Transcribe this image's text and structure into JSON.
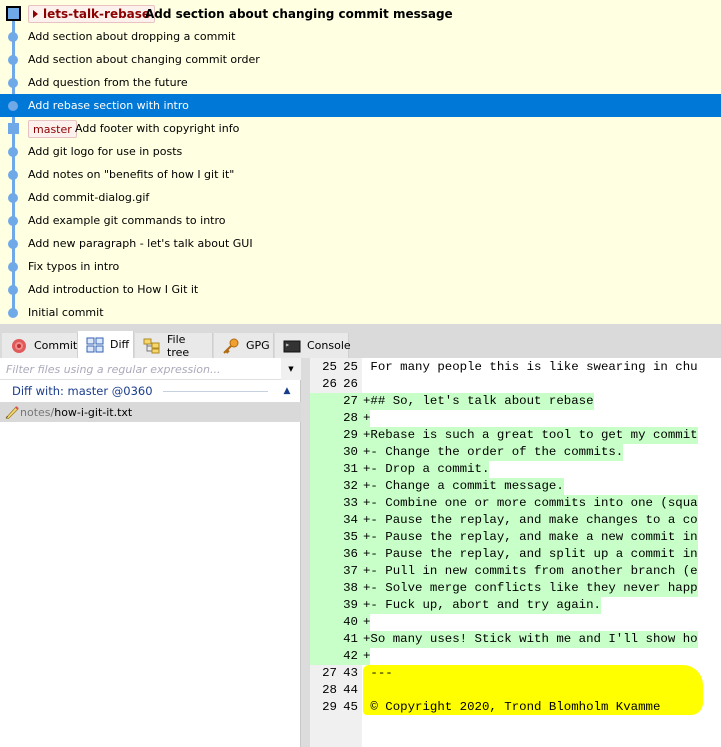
{
  "commit_log": {
    "colors": {
      "background": "#ffffe1",
      "selected": "#0078d7",
      "graph": "#70a9e8",
      "badge_text": "#8b0000"
    },
    "commits": [
      {
        "message": "Add section about changing commit message",
        "branch": "lets-talk-rebase",
        "head": true,
        "bold": true
      },
      {
        "message": "Add section about dropping a commit"
      },
      {
        "message": "Add section about changing commit order"
      },
      {
        "message": "Add question from the future"
      },
      {
        "message": "Add rebase section with intro",
        "selected": true
      },
      {
        "message": "Add footer with copyright info",
        "branch": "master"
      },
      {
        "message": "Add git logo for use in posts"
      },
      {
        "message": "Add notes on \"benefits of how I git it\""
      },
      {
        "message": "Add commit-dialog.gif"
      },
      {
        "message": "Add example git commands to intro"
      },
      {
        "message": "Add new paragraph - let's talk about GUI"
      },
      {
        "message": "Fix typos in intro"
      },
      {
        "message": "Add introduction to How I Git it"
      },
      {
        "message": "Initial commit"
      }
    ]
  },
  "tabs": [
    {
      "label": "Commit",
      "icon": "commit-icon"
    },
    {
      "label": "Diff",
      "icon": "diff-icon",
      "active": true
    },
    {
      "label": "File tree",
      "icon": "file-tree-icon"
    },
    {
      "label": "GPG",
      "icon": "key-icon"
    },
    {
      "label": "Console",
      "icon": "console-icon"
    }
  ],
  "file_panel": {
    "filter_placeholder": "Filter files using a regular expression...",
    "diff_with": "Diff with: master @0360",
    "files": [
      {
        "dir": "notes/",
        "name": "how-i-git-it.txt",
        "status": "modified"
      }
    ]
  },
  "diff": {
    "add_color": "#c8ffc8",
    "highlight_color": "#ffff00",
    "lines": [
      {
        "old": "25",
        "new": "25",
        "text": " For many people this is like swearing in chu",
        "type": "context"
      },
      {
        "old": "26",
        "new": "26",
        "text": "",
        "type": "context"
      },
      {
        "old": "",
        "new": "27",
        "text": "+## So, let's talk about rebase",
        "type": "add"
      },
      {
        "old": "",
        "new": "28",
        "text": "+",
        "type": "add"
      },
      {
        "old": "",
        "new": "29",
        "text": "+Rebase is such a great tool to get my commit",
        "type": "add"
      },
      {
        "old": "",
        "new": "30",
        "text": "+- Change the order of the commits.",
        "type": "add"
      },
      {
        "old": "",
        "new": "31",
        "text": "+- Drop a commit.",
        "type": "add"
      },
      {
        "old": "",
        "new": "32",
        "text": "+- Change a commit message.",
        "type": "add"
      },
      {
        "old": "",
        "new": "33",
        "text": "+- Combine one or more commits into one (squa",
        "type": "add"
      },
      {
        "old": "",
        "new": "34",
        "text": "+- Pause the replay, and make changes to a co",
        "type": "add"
      },
      {
        "old": "",
        "new": "35",
        "text": "+- Pause the replay, and make a new commit in",
        "type": "add"
      },
      {
        "old": "",
        "new": "36",
        "text": "+- Pause the replay, and split up a commit in",
        "type": "add"
      },
      {
        "old": "",
        "new": "37",
        "text": "+- Pull in new commits from another branch (e",
        "type": "add"
      },
      {
        "old": "",
        "new": "38",
        "text": "+- Solve merge conflicts like they never happ",
        "type": "add"
      },
      {
        "old": "",
        "new": "39",
        "text": "+- Fuck up, abort and try again.",
        "type": "add"
      },
      {
        "old": "",
        "new": "40",
        "text": "+",
        "type": "add"
      },
      {
        "old": "",
        "new": "41",
        "text": "+So many uses! Stick with me and I'll show ho",
        "type": "add"
      },
      {
        "old": "",
        "new": "42",
        "text": "+",
        "type": "add"
      },
      {
        "old": "27",
        "new": "43",
        "text": " ---",
        "type": "context"
      },
      {
        "old": "28",
        "new": "44",
        "text": "",
        "type": "context"
      },
      {
        "old": "29",
        "new": "45",
        "text": " © Copyright 2020, Trond Blomholm Kvamme",
        "type": "context"
      }
    ]
  }
}
